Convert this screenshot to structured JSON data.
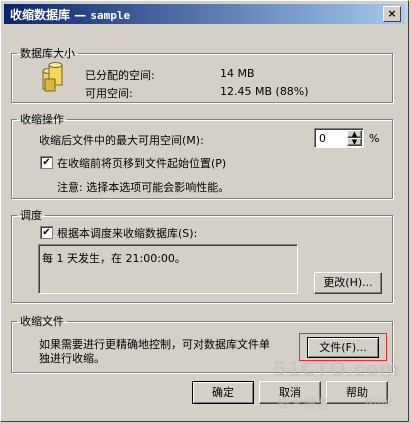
{
  "window": {
    "title_prefix": "收缩数据库 — ",
    "title_db": "sample",
    "close_glyph": "×"
  },
  "db_size": {
    "legend": "数据库大小",
    "allocated_label": "已分配的空间:",
    "allocated_value": "14 MB",
    "available_label": "可用空间:",
    "available_value": "12.45 MB (88%)"
  },
  "shrink_ops": {
    "legend": "收缩操作",
    "max_free_label": "收缩后文件中的最大可用空间(M):",
    "max_free_value": "0",
    "percent": "%",
    "move_pages_label": "在收缩前将页移到文件起始位置(P)",
    "move_pages_checked": "✔",
    "note": "注意: 选择本选项可能会影响性能。"
  },
  "schedule": {
    "legend": "调度",
    "schedule_label": "根据本调度来收缩数据库(S):",
    "schedule_checked": "✔",
    "schedule_text": "每 1 天发生，在 21:00:00。",
    "change_button": "更改(H)..."
  },
  "shrink_file": {
    "legend": "收缩文件",
    "description_line1": "如果需要进行更精确地控制，可对数据库文件单",
    "description_line2": "独进行收缩。",
    "files_button": "文件(F)..."
  },
  "footer": {
    "ok": "确定",
    "cancel": "取消",
    "help": "帮助"
  },
  "watermark": {
    "site": "51CTO.com",
    "blog": "技术博客",
    "suffix": "Blog"
  }
}
